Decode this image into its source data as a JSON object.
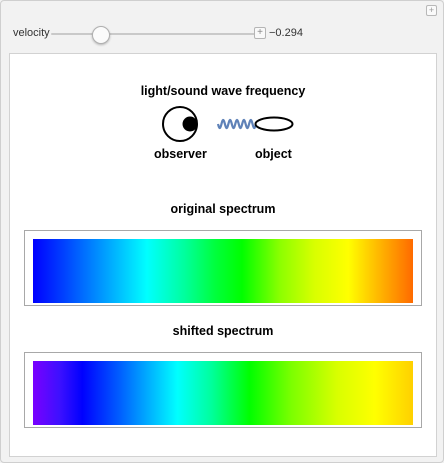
{
  "controls": {
    "velocity_label": "velocity",
    "velocity_value": "−0.294",
    "slider_position_fraction": 0.235
  },
  "diagram": {
    "title": "light/sound wave frequency",
    "observer_label": "observer",
    "object_label": "object",
    "wave_color": "#5f82b8"
  },
  "spectra": {
    "original": {
      "title": "original spectrum",
      "gradient": [
        "#0000ff 0%",
        "#0040ff 8%",
        "#0096ff 18%",
        "#00ffff 30%",
        "#00ff9c 40%",
        "#00ff3c 48%",
        "#00ff00 55%",
        "#8cff00 65%",
        "#d8ff00 74%",
        "#ffff00 83%",
        "#ffc000 90%",
        "#ff6a00 100%"
      ]
    },
    "shifted": {
      "title": "shifted spectrum",
      "gradient": [
        "#7a00ff 0%",
        "#3d10ff 7%",
        "#0000ff 13%",
        "#0060ff 23%",
        "#00ffff 38%",
        "#00ff9c 47%",
        "#00ff00 57%",
        "#7cff00 68%",
        "#d8ff00 80%",
        "#ffff00 90%",
        "#ffd000 100%"
      ]
    }
  }
}
